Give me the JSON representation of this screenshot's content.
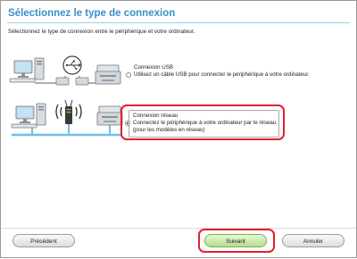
{
  "title": "Sélectionnez le type de connexion",
  "subtitle": "Sélectionnez le type de connexion entre le périphérique et votre ordinateur.",
  "options": {
    "usb": {
      "label": "Connexion USB",
      "description": "Utilisez un câble USB pour connecter le périphérique à votre ordinateur.",
      "selected": false
    },
    "network": {
      "label": "Connexion réseau",
      "description_line1": "Connectez le périphérique à votre ordinateur par le réseau.",
      "description_line2": "(pour les modèles en réseau)",
      "selected": true
    }
  },
  "buttons": {
    "previous": "Précédent",
    "next": "Suivant",
    "cancel": "Annuler"
  },
  "colors": {
    "title": "#3a8fc8",
    "highlight": "#e0202c",
    "next_button": "#b6dd8c",
    "cable": "#6fc0e6"
  },
  "icons": [
    "usb-icon",
    "computer-icon",
    "printer-icon",
    "wifi-icon",
    "router-icon"
  ]
}
